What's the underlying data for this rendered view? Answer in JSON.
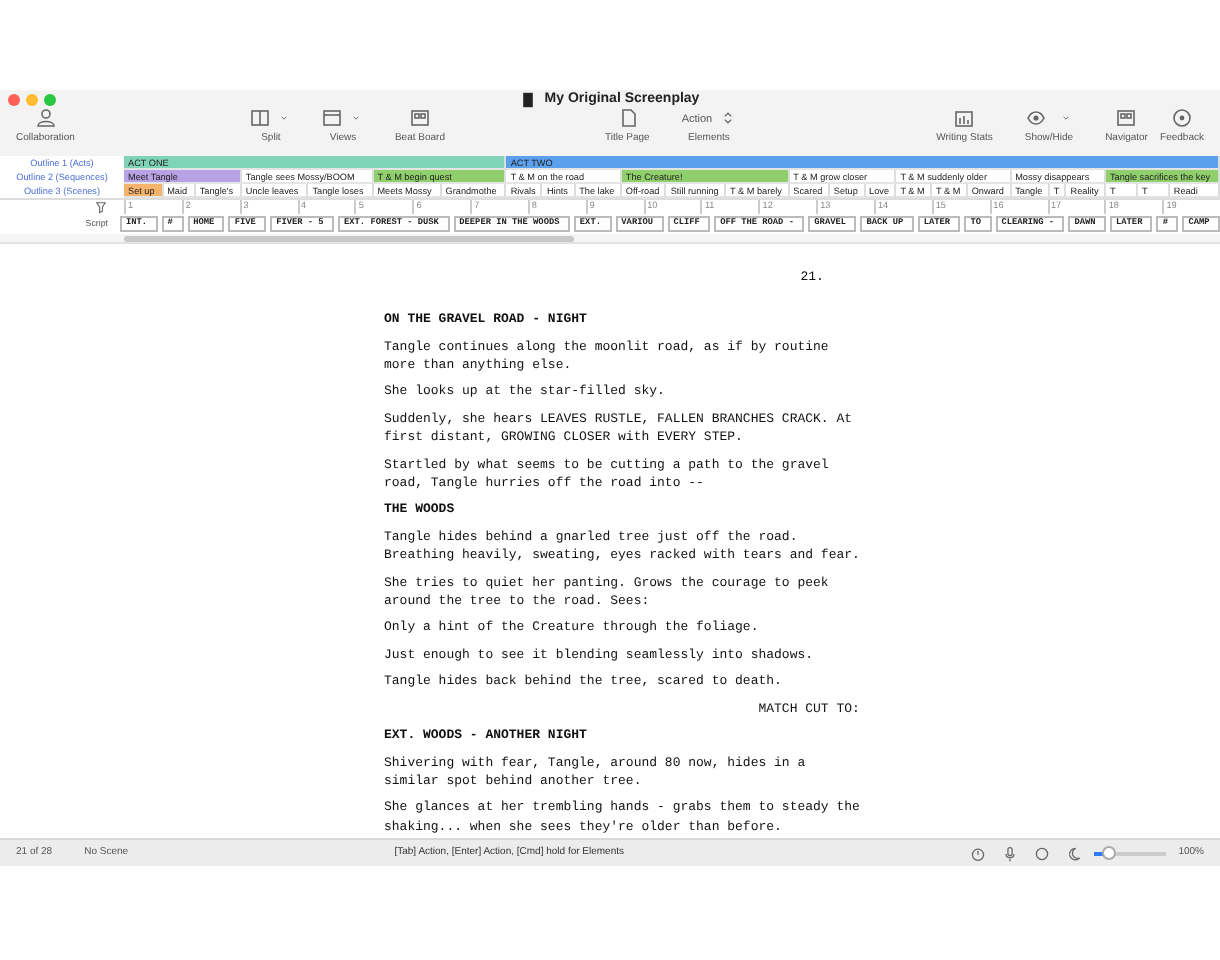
{
  "window": {
    "title": "My Original Screenplay"
  },
  "toolbar": [
    {
      "label": "Collaboration"
    },
    {
      "label": "Split"
    },
    {
      "label": "Views"
    },
    {
      "label": "Beat Board"
    },
    {
      "label": "Title Page"
    },
    {
      "label": "Elements",
      "value": "Action"
    },
    {
      "label": "Writing Stats"
    },
    {
      "label": "Show/Hide"
    },
    {
      "label": "Navigator"
    },
    {
      "label": "Feedback"
    }
  ],
  "outline_labels": [
    "Outline 1 (Acts)",
    "Outline 2 (Sequences)",
    "Outline 3 (Scenes)"
  ],
  "acts": [
    {
      "label": "ACT ONE",
      "color": "#7fd3b6",
      "children": [
        {
          "label": "Meet Tangle",
          "color": "#b8a2e6",
          "children": [
            {
              "label": "Set up",
              "color": "#f4b46c"
            },
            {
              "label": "Maid"
            },
            {
              "label": "Tangle's"
            }
          ]
        },
        {
          "label": "Tangle sees Mossy/BOOM",
          "children": [
            {
              "label": "Uncle leaves"
            },
            {
              "label": "Tangle loses"
            }
          ]
        },
        {
          "label": "T & M begin quest",
          "color": "#8fcf6c",
          "children": [
            {
              "label": "Meets Mossy"
            },
            {
              "label": "Grandmothe"
            }
          ]
        }
      ]
    },
    {
      "label": "ACT TWO",
      "color": "#5aa0ec",
      "children": [
        {
          "label": "T & M on the road",
          "children": [
            {
              "label": "Rivals"
            },
            {
              "label": "Hints"
            },
            {
              "label": "The lake"
            }
          ]
        },
        {
          "label": "The Creature!",
          "color": "#8fcf6c",
          "children": [
            {
              "label": "Off-road"
            },
            {
              "label": "Still running"
            },
            {
              "label": "T & M barely"
            }
          ]
        },
        {
          "label": "T & M grow closer",
          "children": [
            {
              "label": "Scared"
            },
            {
              "label": "Setup"
            },
            {
              "label": "Love"
            }
          ]
        },
        {
          "label": "T & M suddenly older",
          "children": [
            {
              "label": "T & M"
            },
            {
              "label": "T & M"
            },
            {
              "label": "Onward"
            }
          ]
        },
        {
          "label": "Mossy disappears",
          "children": [
            {
              "label": "Tangle"
            },
            {
              "label": "T"
            },
            {
              "label": "Reality"
            }
          ]
        },
        {
          "label": "Tangle sacrifices the key",
          "color": "#8fcf6c",
          "children": [
            {
              "label": "T"
            },
            {
              "label": "T"
            },
            {
              "label": "Readi"
            }
          ]
        }
      ]
    }
  ],
  "ruler": [
    "1",
    "2",
    "3",
    "4",
    "5",
    "6",
    "7",
    "8",
    "9",
    "10",
    "11",
    "12",
    "13",
    "14",
    "15",
    "16",
    "17",
    "18",
    "19"
  ],
  "script_label": "Script",
  "script_cells": [
    "INT.",
    "#",
    "HOME",
    "FIVE",
    "FIVER - 5",
    "EXT. FOREST - DUSK",
    "DEEPER IN THE WOODS",
    "EXT.",
    "VARIOU",
    "CLIFF",
    "OFF THE ROAD -",
    "GRAVEL",
    "BACK UP",
    "LATER",
    "TO",
    "CLEARING -",
    "DAWN",
    "LATER",
    "#",
    "CAMP"
  ],
  "page_number": "21.",
  "script": [
    {
      "kind": "heading",
      "text": "ON THE GRAVEL ROAD - NIGHT"
    },
    {
      "kind": "action",
      "text": "Tangle continues along the moonlit road, as if by routine more than anything else."
    },
    {
      "kind": "action",
      "text": "She looks up at the star-filled sky."
    },
    {
      "kind": "action",
      "text": "Suddenly, she hears LEAVES RUSTLE, FALLEN BRANCHES CRACK. At first distant, GROWING CLOSER with EVERY STEP."
    },
    {
      "kind": "action",
      "text": "Startled by what seems to be cutting a path to the gravel road, Tangle hurries off the road into --"
    },
    {
      "kind": "heading",
      "text": "THE WOODS"
    },
    {
      "kind": "action",
      "text": "Tangle hides behind a gnarled tree just off the road. Breathing heavily, sweating, eyes racked with tears and fear."
    },
    {
      "kind": "action",
      "text": "She tries to quiet her panting. Grows the courage to peek around the tree to the road. Sees:"
    },
    {
      "kind": "action",
      "text": "Only a hint of the Creature through the foliage."
    },
    {
      "kind": "action",
      "text": "Just enough to see it blending seamlessly into shadows."
    },
    {
      "kind": "action",
      "text": "Tangle hides back behind the tree, scared to death."
    },
    {
      "kind": "transition",
      "text": "MATCH CUT TO:"
    },
    {
      "kind": "heading",
      "text": "EXT. WOODS - ANOTHER NIGHT"
    },
    {
      "kind": "action",
      "text": "Shivering with fear, Tangle, around 80 now, hides in a similar spot behind another tree."
    },
    {
      "kind": "action",
      "text": "She glances at her trembling hands - grabs them to steady the shaking... when she sees they're older than before."
    }
  ],
  "status_bar": {
    "page": "21 of 28",
    "scene": "No Scene",
    "hint": "[Tab] Action, [Enter] Action, [Cmd] hold for Elements",
    "zoom": "100%",
    "level": 0.2
  }
}
